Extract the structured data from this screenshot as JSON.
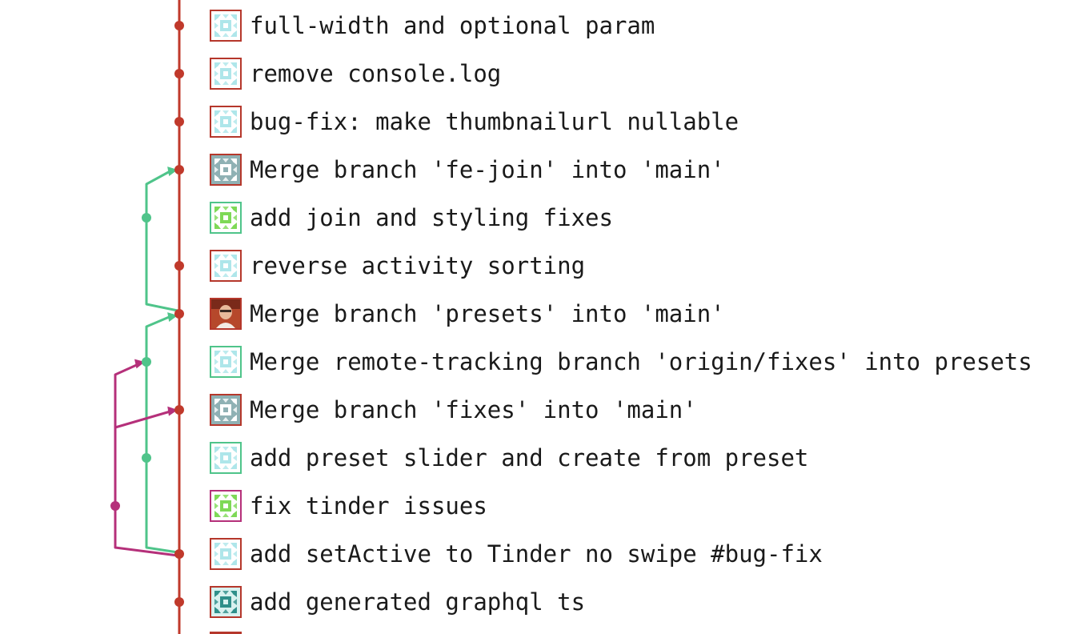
{
  "colors": {
    "main_branch": "#c0392b",
    "green_branch": "#4fc48a",
    "magenta_branch": "#b5307a",
    "avatar_border_main": "#b5372b",
    "avatar_border_green": "#4fc48a",
    "avatar_border_magenta": "#b5307a"
  },
  "commits": [
    {
      "message": "full-width and optional param",
      "avatar": "identicon-lightblue",
      "border": "main"
    },
    {
      "message": "remove console.log",
      "avatar": "identicon-lightblue",
      "border": "main"
    },
    {
      "message": "bug-fix: make thumbnailurl nullable",
      "avatar": "identicon-lightblue",
      "border": "main"
    },
    {
      "message": "Merge branch 'fe-join' into 'main'",
      "avatar": "identicon-gray",
      "border": "main"
    },
    {
      "message": "add join and styling fixes",
      "avatar": "identicon-green",
      "border": "green"
    },
    {
      "message": "reverse activity sorting",
      "avatar": "identicon-lightblue",
      "border": "main"
    },
    {
      "message": "Merge branch 'presets' into 'main'",
      "avatar": "photo-avatar",
      "border": "main"
    },
    {
      "message": "Merge remote-tracking branch 'origin/fixes' into presets",
      "avatar": "identicon-lightblue",
      "border": "green"
    },
    {
      "message": "Merge branch 'fixes' into 'main'",
      "avatar": "identicon-gray",
      "border": "main"
    },
    {
      "message": "add preset slider and create from preset",
      "avatar": "identicon-lightblue",
      "border": "green"
    },
    {
      "message": "fix tinder issues",
      "avatar": "identicon-green",
      "border": "magenta"
    },
    {
      "message": "add setActive to Tinder no swipe #bug-fix",
      "avatar": "identicon-lightblue",
      "border": "main"
    },
    {
      "message": "add generated graphql ts",
      "avatar": "identicon-teal",
      "border": "main"
    }
  ]
}
